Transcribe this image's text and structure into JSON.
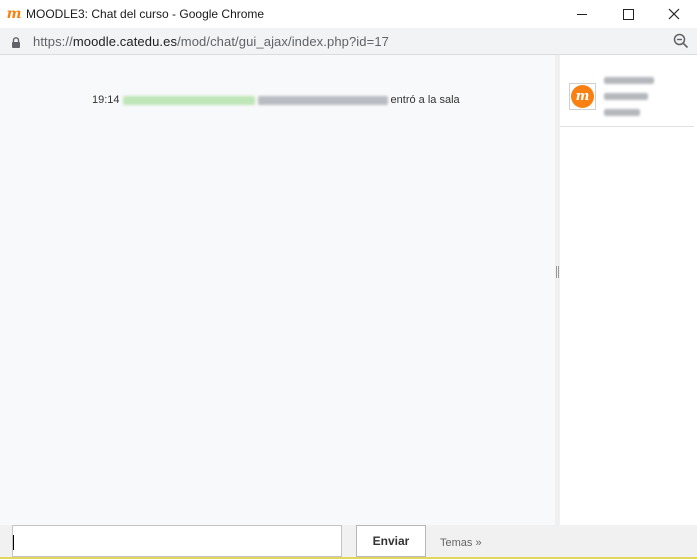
{
  "window": {
    "title": "MOODLE3: Chat del curso - Google Chrome",
    "app_icon_glyph": "m"
  },
  "address": {
    "scheme": "https://",
    "host": "moodle.catedu.es",
    "path": "/mod/chat/gui_ajax/index.php?id=17"
  },
  "chat": {
    "messages": [
      {
        "time": "19:14",
        "text": "entró a la sala"
      }
    ]
  },
  "users": [
    {
      "avatar_glyph": "m"
    }
  ],
  "composer": {
    "input_value": "",
    "send_label": "Enviar",
    "themes_label": "Temas »"
  },
  "colors": {
    "moodle_orange": "#f98012",
    "chat_background": "#f8f9fa"
  },
  "icons": [
    "moodle-icon",
    "lock-icon",
    "zoom-icon",
    "minimize-icon",
    "maximize-icon",
    "close-icon"
  ]
}
